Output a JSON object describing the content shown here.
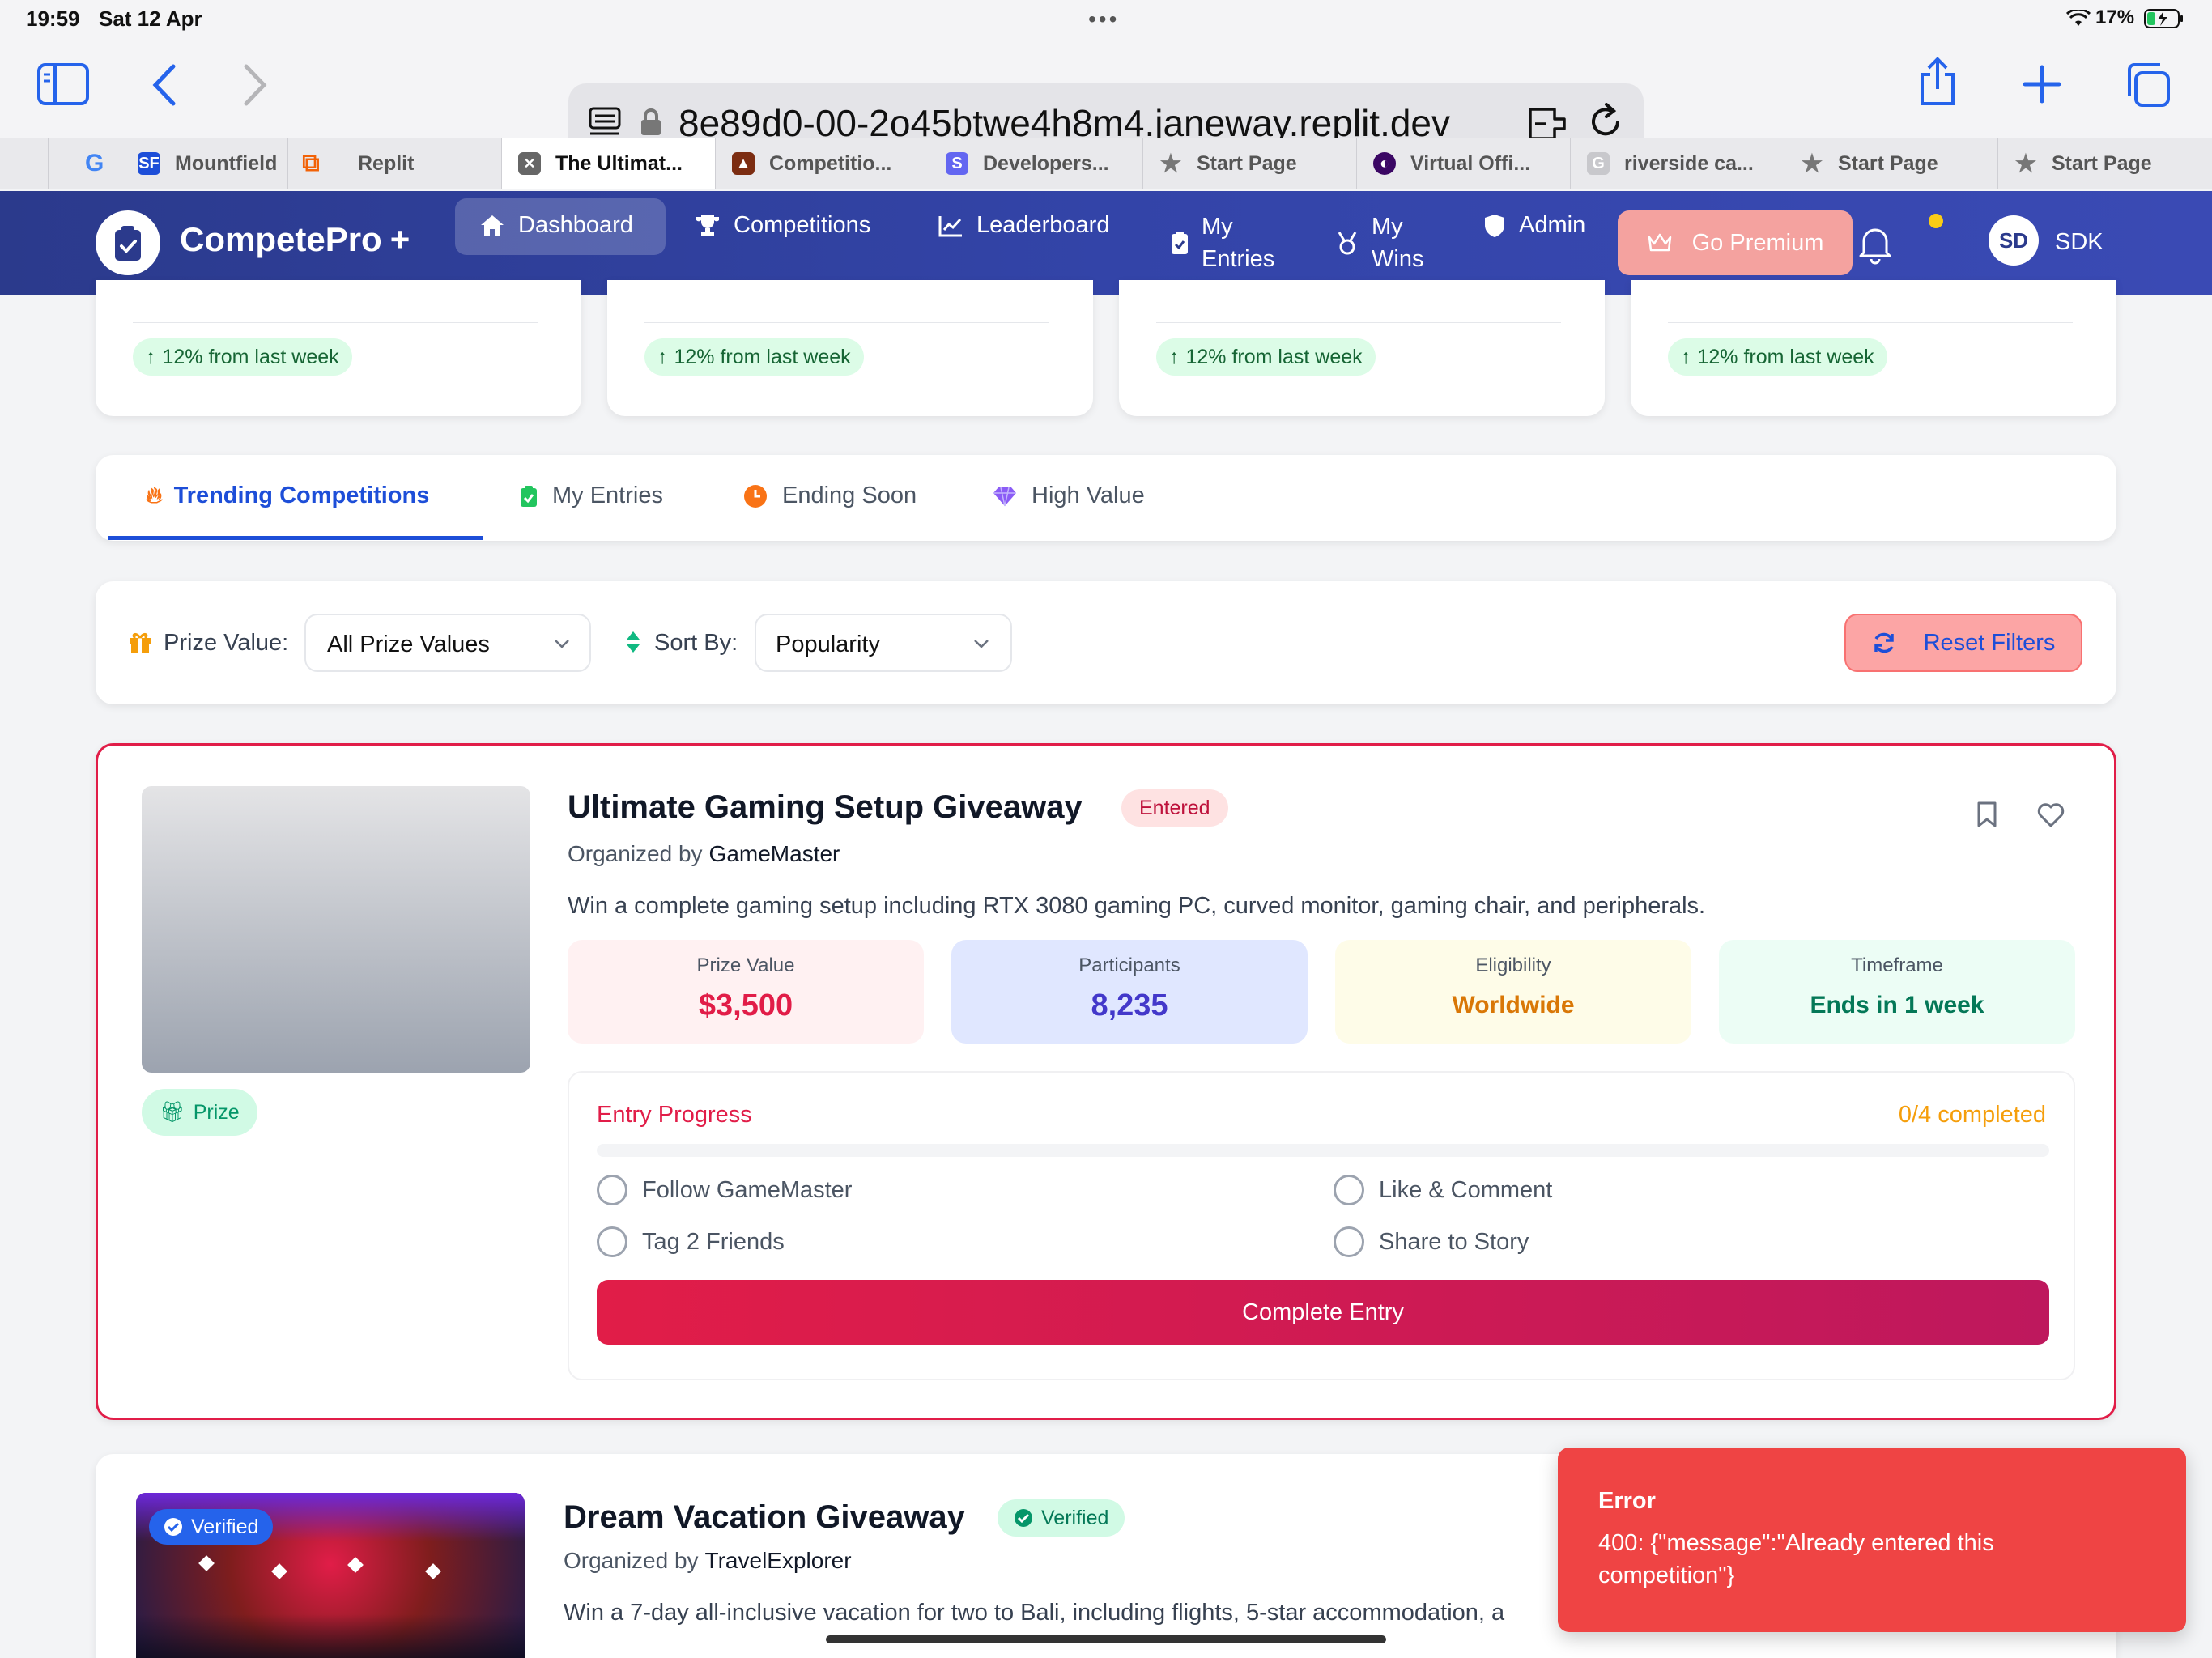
{
  "status_bar": {
    "time": "19:59",
    "date": "Sat 12 Apr",
    "battery": "17%"
  },
  "browser": {
    "url": "8e89d0-00-2o45btwe4h8m4.janeway.replit.dev",
    "tabs": [
      {
        "label": "Mountfield",
        "color": "#1d4ed8"
      },
      {
        "label": "Replit",
        "color": "#f26207"
      },
      {
        "label": "The Ultimat...",
        "color": "#555555",
        "active": true
      },
      {
        "label": "Competitio...",
        "color": "#c2410c"
      },
      {
        "label": "Developers...",
        "color": "#6366f1"
      },
      {
        "label": "Start Page",
        "color": "#888888"
      },
      {
        "label": "Virtual Offi...",
        "color": "#5b21b6"
      },
      {
        "label": "riverside ca...",
        "color": "#bdbdbd"
      },
      {
        "label": "Start Page",
        "color": "#888888"
      },
      {
        "label": "Start Page",
        "color": "#888888"
      }
    ]
  },
  "app": {
    "brand": "CompetePro",
    "brand_plus": "+",
    "nav": {
      "dashboard": "Dashboard",
      "competitions": "Competitions",
      "leaderboard": "Leaderboard",
      "my_entries_1": "My",
      "my_entries_2": "Entries",
      "my_wins_1": "My",
      "my_wins_2": "Wins",
      "admin": "Admin",
      "premium": "Go Premium",
      "avatar": "SD",
      "user": "SDK"
    }
  },
  "stats_trend": [
    "12% from last week",
    "12% from last week",
    "12% from last week",
    "12% from last week"
  ],
  "tabs": {
    "trending": "Trending Competitions",
    "entries": "My Entries",
    "ending": "Ending Soon",
    "high": "High Value"
  },
  "filters": {
    "prize_label": "Prize Value:",
    "prize_value": "All Prize Values",
    "sort_label": "Sort By:",
    "sort_value": "Popularity",
    "reset": "Reset Filters"
  },
  "competition1": {
    "title": "Ultimate Gaming Setup Giveaway",
    "badge": "Entered",
    "organized_prefix": "Organized by",
    "organizer": "GameMaster",
    "description": "Win a complete gaming setup including RTX 3080 gaming PC, curved monitor, gaming chair, and peripherals.",
    "tag": "Prize",
    "stats": {
      "prize_label": "Prize Value",
      "prize_value": "$3,500",
      "participants_label": "Participants",
      "participants_value": "8,235",
      "eligibility_label": "Eligibility",
      "eligibility_value": "Worldwide",
      "timeframe_label": "Timeframe",
      "timeframe_value": "Ends in 1 week"
    },
    "progress": {
      "label": "Entry Progress",
      "count": "0/4 completed",
      "fraction": 0,
      "tasks": [
        "Follow GameMaster",
        "Like & Comment",
        "Tag 2 Friends",
        "Share to Story"
      ],
      "button": "Complete Entry"
    }
  },
  "competition2": {
    "verified_overlay": "Verified",
    "title": "Dream Vacation Giveaway",
    "badge": "Verified",
    "organized_prefix": "Organized by",
    "organizer": "TravelExplorer",
    "description": "Win a 7-day all-inclusive vacation for two to Bali, including flights, 5-star accommodation, a"
  },
  "toast": {
    "title": "Error",
    "message": "400: {\"message\":\"Already entered this competition\"}"
  }
}
